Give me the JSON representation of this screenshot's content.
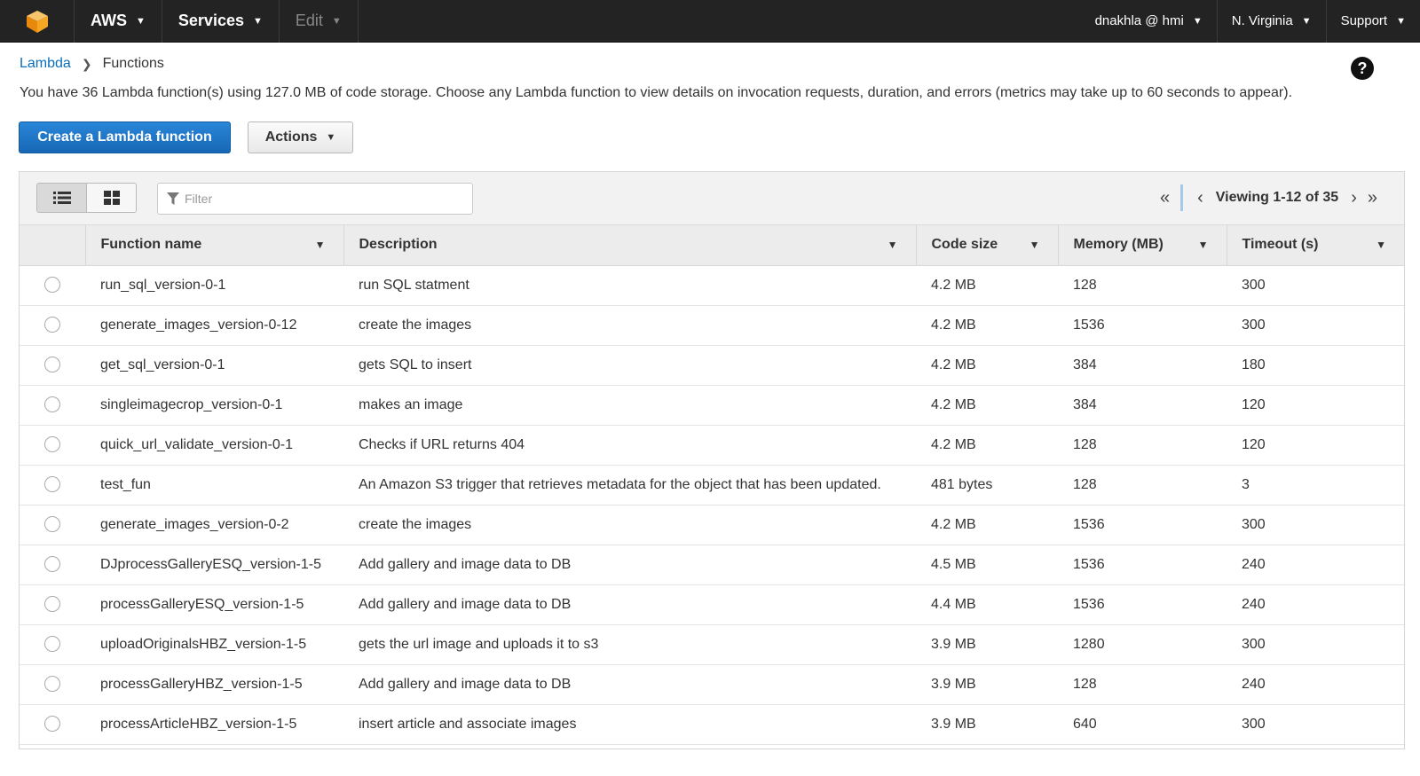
{
  "nav": {
    "brand": "AWS",
    "services": "Services",
    "edit": "Edit",
    "user": "dnakhla @ hmi",
    "region": "N. Virginia",
    "support": "Support"
  },
  "breadcrumb": {
    "root": "Lambda",
    "current": "Functions"
  },
  "help_label": "?",
  "info_text": "You have 36 Lambda function(s) using 127.0 MB of code storage. Choose any Lambda function to view details on invocation requests, duration, and errors (metrics may take up to 60 seconds to appear).",
  "buttons": {
    "create": "Create a Lambda function",
    "actions": "Actions"
  },
  "filter": {
    "placeholder": "Filter"
  },
  "pager": {
    "text": "Viewing 1-12 of 35"
  },
  "table": {
    "headers": [
      "Function name",
      "Description",
      "Code size",
      "Memory (MB)",
      "Timeout (s)"
    ],
    "rows": [
      {
        "name": "run_sql_version-0-1",
        "description": "run SQL statment",
        "code_size": "4.2 MB",
        "memory": "128",
        "timeout": "300"
      },
      {
        "name": "generate_images_version-0-12",
        "description": "create the images",
        "code_size": "4.2 MB",
        "memory": "1536",
        "timeout": "300"
      },
      {
        "name": "get_sql_version-0-1",
        "description": "gets SQL to insert",
        "code_size": "4.2 MB",
        "memory": "384",
        "timeout": "180"
      },
      {
        "name": "singleimagecrop_version-0-1",
        "description": "makes an image",
        "code_size": "4.2 MB",
        "memory": "384",
        "timeout": "120"
      },
      {
        "name": "quick_url_validate_version-0-1",
        "description": "Checks if URL returns 404",
        "code_size": "4.2 MB",
        "memory": "128",
        "timeout": "120"
      },
      {
        "name": "test_fun",
        "description": "An Amazon S3 trigger that retrieves metadata for the object that has been updated.",
        "code_size": "481 bytes",
        "memory": "128",
        "timeout": "3"
      },
      {
        "name": "generate_images_version-0-2",
        "description": "create the images",
        "code_size": "4.2 MB",
        "memory": "1536",
        "timeout": "300"
      },
      {
        "name": "DJprocessGalleryESQ_version-1-5",
        "description": "Add gallery and image data to DB",
        "code_size": "4.5 MB",
        "memory": "1536",
        "timeout": "240"
      },
      {
        "name": "processGalleryESQ_version-1-5",
        "description": "Add gallery and image data to DB",
        "code_size": "4.4 MB",
        "memory": "1536",
        "timeout": "240"
      },
      {
        "name": "uploadOriginalsHBZ_version-1-5",
        "description": "gets the url image and uploads it to s3",
        "code_size": "3.9 MB",
        "memory": "1280",
        "timeout": "300"
      },
      {
        "name": "processGalleryHBZ_version-1-5",
        "description": "Add gallery and image data to DB",
        "code_size": "3.9 MB",
        "memory": "128",
        "timeout": "240"
      },
      {
        "name": "processArticleHBZ_version-1-5",
        "description": "insert article and associate images",
        "code_size": "3.9 MB",
        "memory": "640",
        "timeout": "300"
      }
    ]
  },
  "colors": {
    "nav_bg": "#232323",
    "primary": "#1f77c9",
    "link": "#0a6ebd",
    "logo": "#f5a623"
  },
  "icons": [
    "aws-cube-icon",
    "caret-down-icon",
    "help-icon",
    "list-view-icon",
    "grid-view-icon",
    "filter-icon",
    "first-page-icon",
    "prev-page-icon",
    "next-page-icon",
    "last-page-icon",
    "sort-icon",
    "radio-icon"
  ]
}
